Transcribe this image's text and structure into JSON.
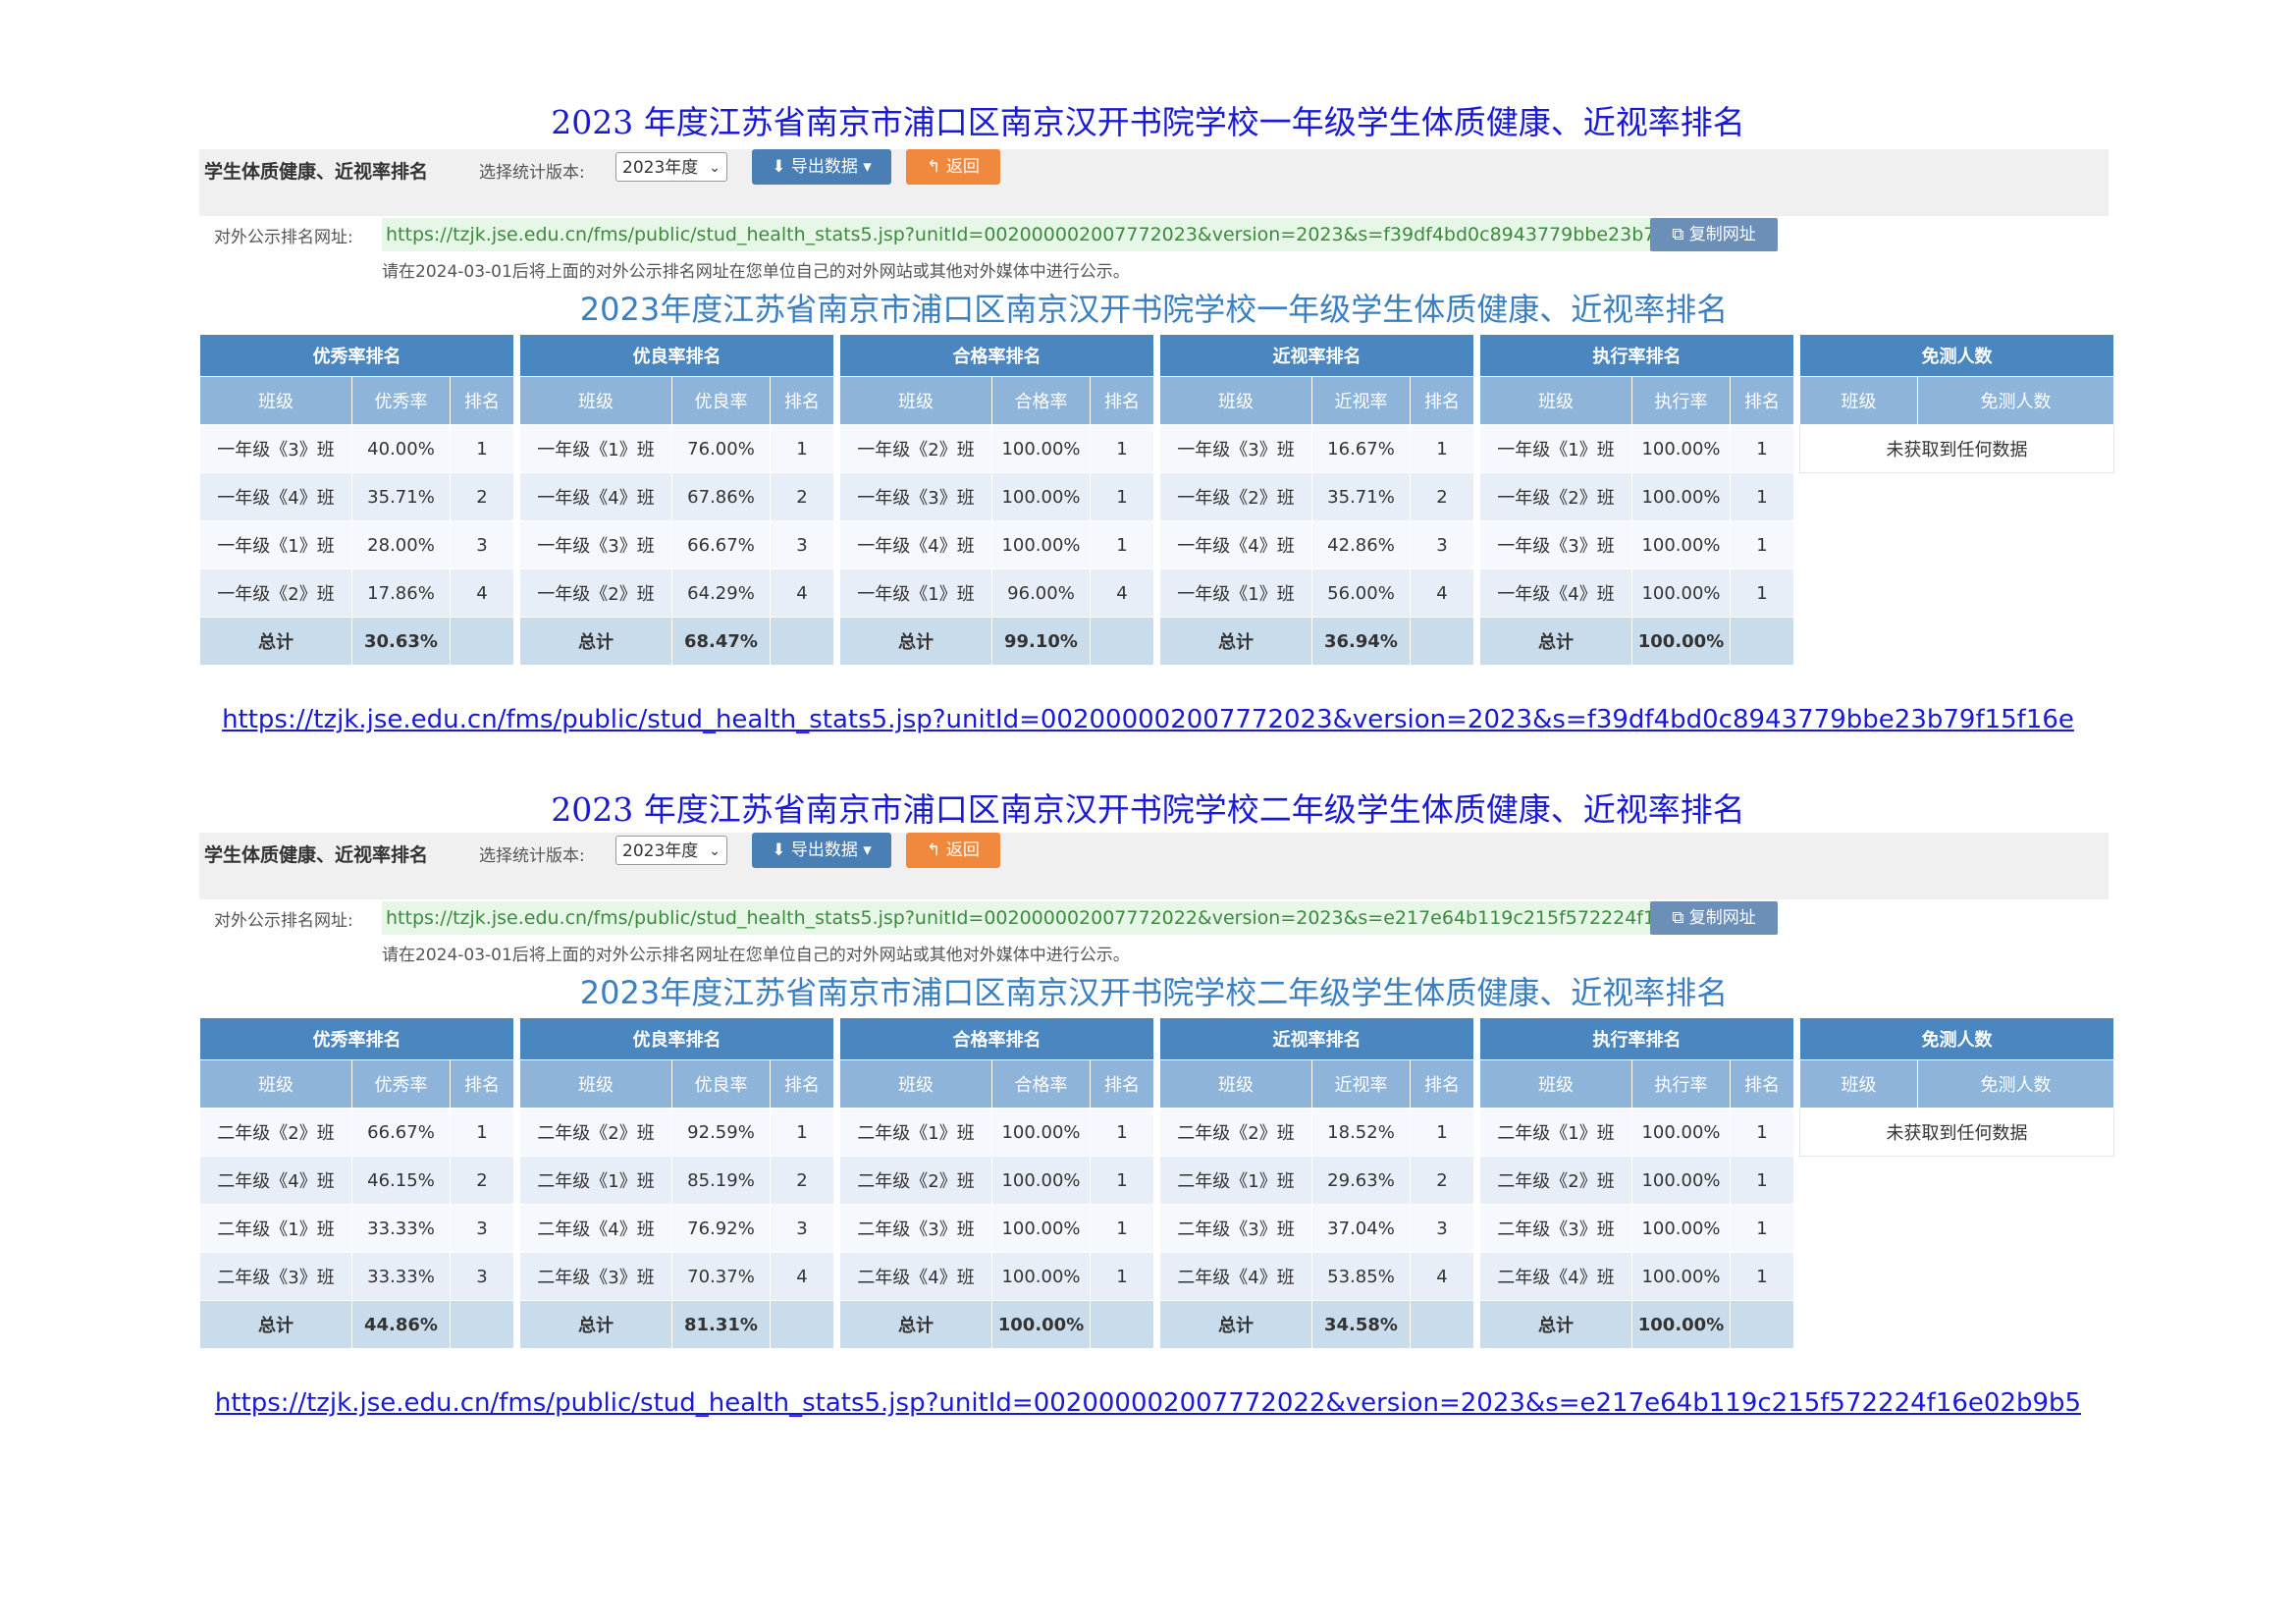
{
  "sections": [
    {
      "doc_title": "2023 年度江苏省南京市浦口区南京汉开书院学校一年级学生体质健康、近视率排名",
      "toolbar_title": "学生体质健康、近视率排名",
      "version_label": "选择统计版本:",
      "version_value": "2023年度",
      "export_label": "导出数据",
      "back_label": "返回",
      "url_label": "对外公示排名网址:",
      "url": "https://tzjk.jse.edu.cn/fms/public/stud_health_stats5.jsp?unitId=002000002007772023&version=2023&s=f39df4bd0c8943779bbe23b79f15f16e",
      "copy_label": "复制网址",
      "notice": "请在2024-03-01后将上面的对外公示排名网址在您单位自己的对外网站或其他对外媒体中进行公示。",
      "inner_title": "2023年度江苏省南京市浦口区南京汉开书院学校一年级学生体质健康、近视率排名",
      "tables": [
        {
          "title": "优秀率排名",
          "cols": [
            "班级",
            "优秀率",
            "排名"
          ],
          "rows": [
            [
              "一年级《3》班",
              "40.00%",
              "1"
            ],
            [
              "一年级《4》班",
              "35.71%",
              "2"
            ],
            [
              "一年级《1》班",
              "28.00%",
              "3"
            ],
            [
              "一年级《2》班",
              "17.86%",
              "4"
            ]
          ],
          "total": [
            "总计",
            "30.63%",
            ""
          ]
        },
        {
          "title": "优良率排名",
          "cols": [
            "班级",
            "优良率",
            "排名"
          ],
          "rows": [
            [
              "一年级《1》班",
              "76.00%",
              "1"
            ],
            [
              "一年级《4》班",
              "67.86%",
              "2"
            ],
            [
              "一年级《3》班",
              "66.67%",
              "3"
            ],
            [
              "一年级《2》班",
              "64.29%",
              "4"
            ]
          ],
          "total": [
            "总计",
            "68.47%",
            ""
          ]
        },
        {
          "title": "合格率排名",
          "cols": [
            "班级",
            "合格率",
            "排名"
          ],
          "rows": [
            [
              "一年级《2》班",
              "100.00%",
              "1"
            ],
            [
              "一年级《3》班",
              "100.00%",
              "1"
            ],
            [
              "一年级《4》班",
              "100.00%",
              "1"
            ],
            [
              "一年级《1》班",
              "96.00%",
              "4"
            ]
          ],
          "total": [
            "总计",
            "99.10%",
            ""
          ]
        },
        {
          "title": "近视率排名",
          "cols": [
            "班级",
            "近视率",
            "排名"
          ],
          "rows": [
            [
              "一年级《3》班",
              "16.67%",
              "1"
            ],
            [
              "一年级《2》班",
              "35.71%",
              "2"
            ],
            [
              "一年级《4》班",
              "42.86%",
              "3"
            ],
            [
              "一年级《1》班",
              "56.00%",
              "4"
            ]
          ],
          "total": [
            "总计",
            "36.94%",
            ""
          ]
        },
        {
          "title": "执行率排名",
          "cols": [
            "班级",
            "执行率",
            "排名"
          ],
          "rows": [
            [
              "一年级《1》班",
              "100.00%",
              "1"
            ],
            [
              "一年级《2》班",
              "100.00%",
              "1"
            ],
            [
              "一年级《3》班",
              "100.00%",
              "1"
            ],
            [
              "一年级《4》班",
              "100.00%",
              "1"
            ]
          ],
          "total": [
            "总计",
            "100.00%",
            ""
          ]
        }
      ],
      "exempt": {
        "title": "免测人数",
        "cols": [
          "班级",
          "免测人数"
        ],
        "empty": "未获取到任何数据"
      },
      "link": "https://tzjk.jse.edu.cn/fms/public/stud_health_stats5.jsp?unitId=002000002007772023&version=2023&s=f39df4bd0c8943779bbe23b79f15f16e"
    },
    {
      "doc_title": "2023 年度江苏省南京市浦口区南京汉开书院学校二年级学生体质健康、近视率排名",
      "toolbar_title": "学生体质健康、近视率排名",
      "version_label": "选择统计版本:",
      "version_value": "2023年度",
      "export_label": "导出数据",
      "back_label": "返回",
      "url_label": "对外公示排名网址:",
      "url": "https://tzjk.jse.edu.cn/fms/public/stud_health_stats5.jsp?unitId=002000002007772022&version=2023&s=e217e64b119c215f572224f16e02b9b5",
      "copy_label": "复制网址",
      "notice": "请在2024-03-01后将上面的对外公示排名网址在您单位自己的对外网站或其他对外媒体中进行公示。",
      "inner_title": "2023年度江苏省南京市浦口区南京汉开书院学校二年级学生体质健康、近视率排名",
      "tables": [
        {
          "title": "优秀率排名",
          "cols": [
            "班级",
            "优秀率",
            "排名"
          ],
          "rows": [
            [
              "二年级《2》班",
              "66.67%",
              "1"
            ],
            [
              "二年级《4》班",
              "46.15%",
              "2"
            ],
            [
              "二年级《1》班",
              "33.33%",
              "3"
            ],
            [
              "二年级《3》班",
              "33.33%",
              "3"
            ]
          ],
          "total": [
            "总计",
            "44.86%",
            ""
          ]
        },
        {
          "title": "优良率排名",
          "cols": [
            "班级",
            "优良率",
            "排名"
          ],
          "rows": [
            [
              "二年级《2》班",
              "92.59%",
              "1"
            ],
            [
              "二年级《1》班",
              "85.19%",
              "2"
            ],
            [
              "二年级《4》班",
              "76.92%",
              "3"
            ],
            [
              "二年级《3》班",
              "70.37%",
              "4"
            ]
          ],
          "total": [
            "总计",
            "81.31%",
            ""
          ]
        },
        {
          "title": "合格率排名",
          "cols": [
            "班级",
            "合格率",
            "排名"
          ],
          "rows": [
            [
              "二年级《1》班",
              "100.00%",
              "1"
            ],
            [
              "二年级《2》班",
              "100.00%",
              "1"
            ],
            [
              "二年级《3》班",
              "100.00%",
              "1"
            ],
            [
              "二年级《4》班",
              "100.00%",
              "1"
            ]
          ],
          "total": [
            "总计",
            "100.00%",
            ""
          ]
        },
        {
          "title": "近视率排名",
          "cols": [
            "班级",
            "近视率",
            "排名"
          ],
          "rows": [
            [
              "二年级《2》班",
              "18.52%",
              "1"
            ],
            [
              "二年级《1》班",
              "29.63%",
              "2"
            ],
            [
              "二年级《3》班",
              "37.04%",
              "3"
            ],
            [
              "二年级《4》班",
              "53.85%",
              "4"
            ]
          ],
          "total": [
            "总计",
            "34.58%",
            ""
          ]
        },
        {
          "title": "执行率排名",
          "cols": [
            "班级",
            "执行率",
            "排名"
          ],
          "rows": [
            [
              "二年级《1》班",
              "100.00%",
              "1"
            ],
            [
              "二年级《2》班",
              "100.00%",
              "1"
            ],
            [
              "二年级《3》班",
              "100.00%",
              "1"
            ],
            [
              "二年级《4》班",
              "100.00%",
              "1"
            ]
          ],
          "total": [
            "总计",
            "100.00%",
            ""
          ]
        }
      ],
      "exempt": {
        "title": "免测人数",
        "cols": [
          "班级",
          "免测人数"
        ],
        "empty": "未获取到任何数据"
      },
      "link": "https://tzjk.jse.edu.cn/fms/public/stud_health_stats5.jsp?unitId=002000002007772022&version=2023&s=e217e64b119c215f572224f16e02b9b5"
    }
  ]
}
